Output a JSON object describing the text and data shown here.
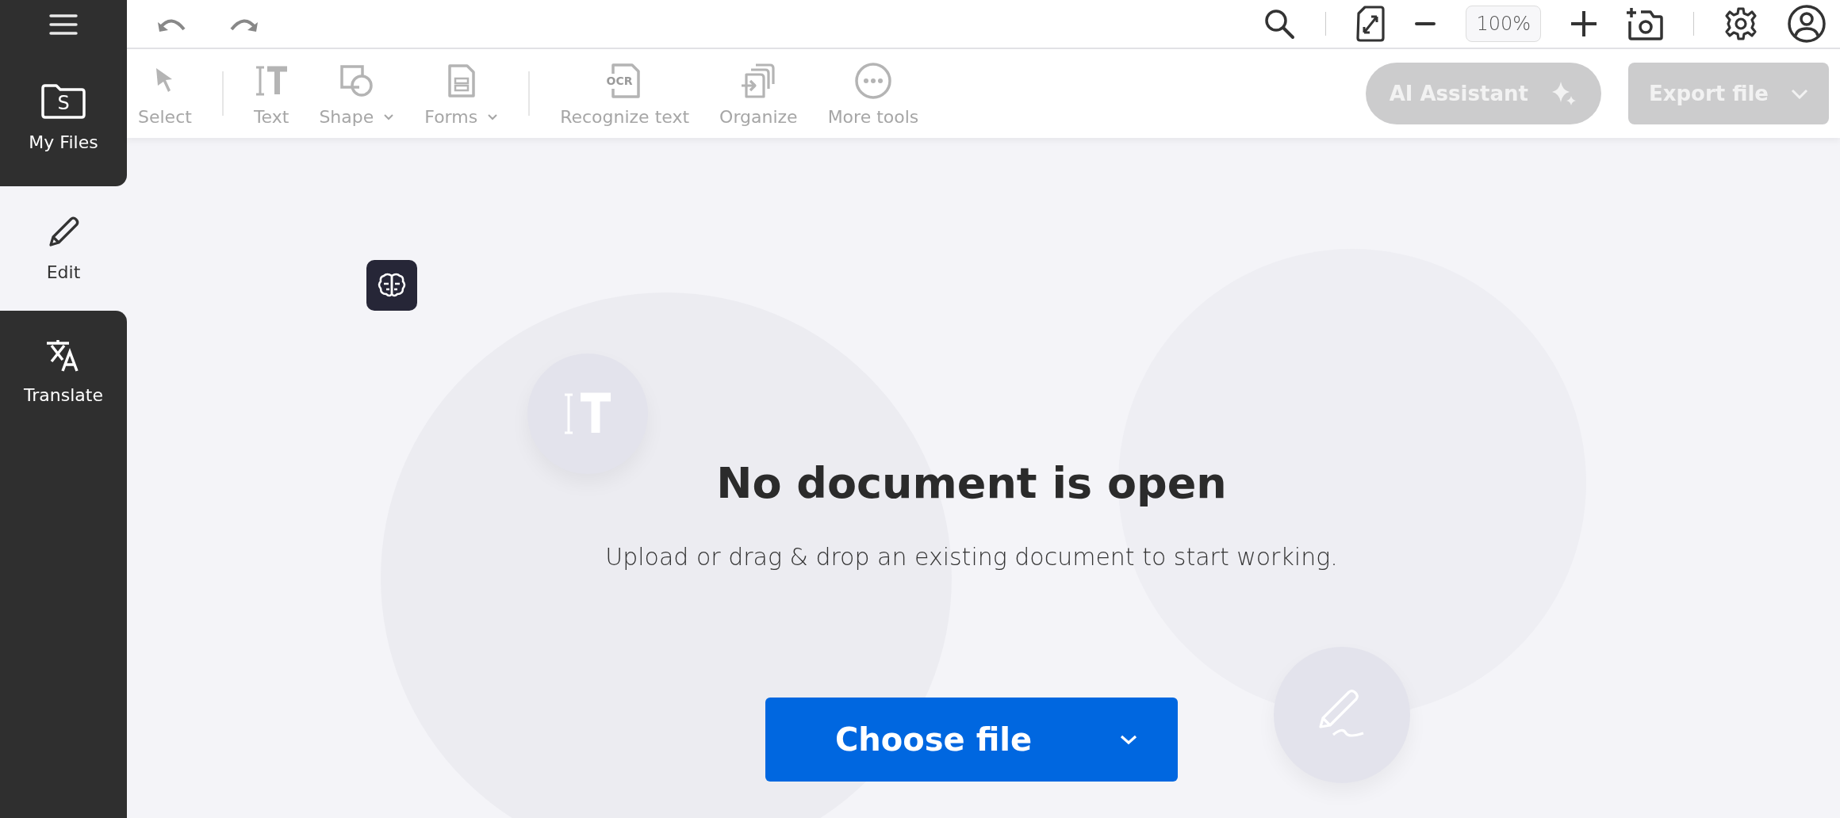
{
  "sidebar": {
    "items": [
      {
        "kind": "files",
        "label": "My Files",
        "badge": "S",
        "selected": false
      },
      {
        "kind": "edit",
        "label": "Edit",
        "selected": true
      },
      {
        "kind": "translate",
        "label": "Translate",
        "selected": false
      }
    ]
  },
  "topbar": {
    "zoom": "100%"
  },
  "toolbar": {
    "tools": [
      {
        "kind": "select",
        "label": "Select",
        "dropdown": false,
        "disabled": true
      },
      {
        "kind": "separator"
      },
      {
        "kind": "text",
        "label": "Text",
        "dropdown": false,
        "disabled": true
      },
      {
        "kind": "shape",
        "label": "Shape",
        "dropdown": true,
        "disabled": true
      },
      {
        "kind": "forms",
        "label": "Forms",
        "dropdown": true,
        "disabled": true
      },
      {
        "kind": "separator"
      },
      {
        "kind": "ocr",
        "label": "Recognize text",
        "badge": "OCR",
        "dropdown": false,
        "disabled": true
      },
      {
        "kind": "organize",
        "label": "Organize",
        "dropdown": false,
        "disabled": true
      },
      {
        "kind": "more",
        "label": "More tools",
        "dropdown": false,
        "disabled": true
      }
    ],
    "ai_button": {
      "label": "AI Assistant",
      "disabled": true
    },
    "export_button": {
      "label": "Export file",
      "disabled": true
    }
  },
  "empty_state": {
    "title": "No document is open",
    "message": "Upload or drag & drop an existing document to start working.",
    "button": "Choose file"
  }
}
